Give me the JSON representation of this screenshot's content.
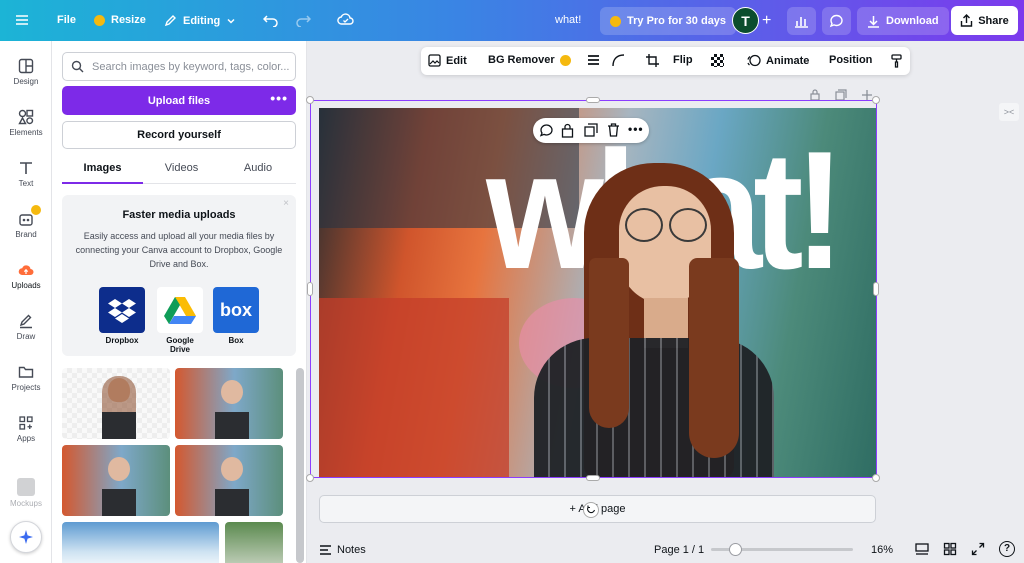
{
  "topbar": {
    "file_label": "File",
    "resize_label": "Resize",
    "editing_label": "Editing",
    "doc_title": "what!",
    "try_pro_label": "Try Pro for 30 days",
    "avatar_initial": "T",
    "download_label": "Download",
    "share_label": "Share"
  },
  "rail": {
    "items": [
      {
        "label": "Design"
      },
      {
        "label": "Elements"
      },
      {
        "label": "Text"
      },
      {
        "label": "Brand"
      },
      {
        "label": "Uploads"
      },
      {
        "label": "Draw"
      },
      {
        "label": "Projects"
      },
      {
        "label": "Apps"
      },
      {
        "label": "Mockups"
      }
    ]
  },
  "panel": {
    "search_placeholder": "Search images by keyword, tags, color...",
    "upload_label": "Upload files",
    "record_label": "Record yourself",
    "tabs": [
      {
        "label": "Images"
      },
      {
        "label": "Videos"
      },
      {
        "label": "Audio"
      }
    ],
    "promo": {
      "title": "Faster media uploads",
      "body": "Easily access and upload all your media files by connecting your Canva account to Dropbox, Google Drive and Box.",
      "services": [
        {
          "label": "Dropbox"
        },
        {
          "label": "Google Drive"
        },
        {
          "label": "Box"
        }
      ]
    }
  },
  "toolbar": {
    "edit_label": "Edit",
    "bg_remover_label": "BG Remover",
    "flip_label": "Flip",
    "animate_label": "Animate",
    "position_label": "Position"
  },
  "canvas": {
    "headline": "what!"
  },
  "add_page_label": "+ Add page",
  "bottom": {
    "notes_label": "Notes",
    "page_label": "Page 1 / 1",
    "zoom_label": "16%",
    "zoom_level": 0.16
  },
  "colors": {
    "accent": "#7d2ae8",
    "selection": "#8b3dff",
    "avatar_bg": "#0b4d2d"
  }
}
